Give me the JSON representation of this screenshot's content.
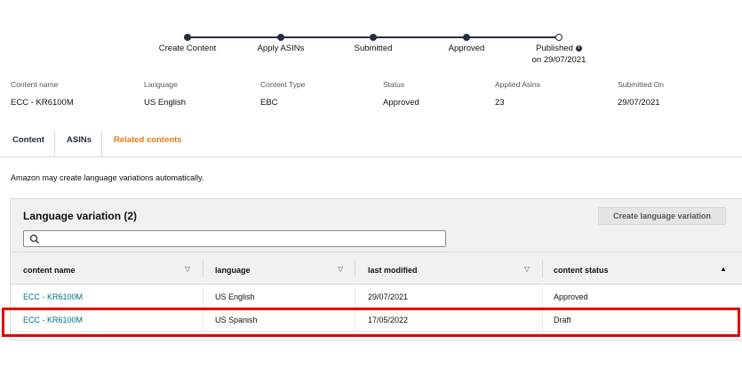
{
  "progress": {
    "steps": [
      {
        "label": "Create Content",
        "done": true
      },
      {
        "label": "Apply ASINs",
        "done": true
      },
      {
        "label": "Submitted",
        "done": true
      },
      {
        "label": "Approved",
        "done": true
      },
      {
        "label": "Published",
        "sublabel": "on 29/07/2021",
        "done": false
      }
    ]
  },
  "details": [
    {
      "key": "Content name",
      "value": "ECC - KR6100M"
    },
    {
      "key": "Language",
      "value": "US English"
    },
    {
      "key": "Content Type",
      "value": "EBC"
    },
    {
      "key": "Status",
      "value": "Approved"
    },
    {
      "key": "Applied Asins",
      "value": "23"
    },
    {
      "key": "Submitted On",
      "value": "29/07/2021"
    }
  ],
  "tabs": [
    {
      "label": "Content"
    },
    {
      "label": "ASINs"
    },
    {
      "label": "Related contents",
      "active": true
    }
  ],
  "note": "Amazon may create language variations automatically.",
  "panel": {
    "title": "Language variation (2)",
    "create_button": "Create language variation",
    "search_placeholder": "",
    "columns": [
      {
        "label": "content name",
        "sort": "▽"
      },
      {
        "label": "language",
        "sort": "▽"
      },
      {
        "label": "last modified",
        "sort": "▽"
      },
      {
        "label": "content status",
        "sort": "▲"
      }
    ],
    "rows": [
      {
        "name": "ECC - KR6100M",
        "language": "US English",
        "modified": "29/07/2021",
        "status": "Approved"
      },
      {
        "name": "ECC - KR6100M",
        "language": "US Spanish",
        "modified": "17/05/2022",
        "status": "Draft"
      }
    ]
  },
  "colors": {
    "accent_tab": "#e47911",
    "link": "#007185",
    "highlight": "#e60000"
  }
}
